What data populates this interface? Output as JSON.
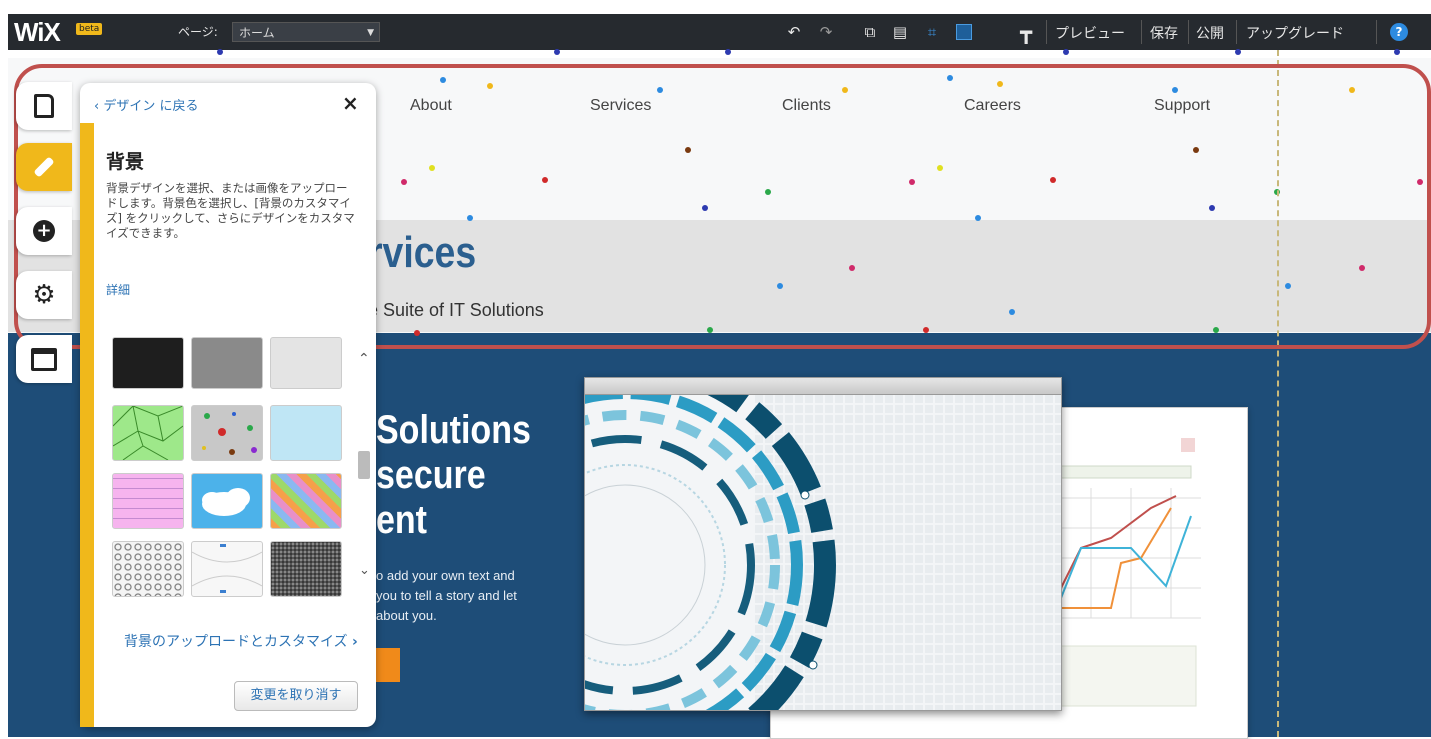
{
  "toolbar": {
    "logo": "WiX",
    "logo_badge": "beta",
    "page_label": "ページ:",
    "page_select": "ホーム",
    "preview": "プレビュー",
    "save": "保存",
    "publish": "公開",
    "upgrade": "アップグレード",
    "help": "?"
  },
  "site": {
    "nav": [
      "About",
      "Services",
      "Clients",
      "Careers",
      "Support"
    ],
    "hero_title_partial": "rvices",
    "hero_subtitle_partial": "e Suite of IT Solutions",
    "headline_lines": [
      "Solutions",
      "secure",
      "ent"
    ],
    "body_lines": [
      "o add your own text and",
      "you to tell a story and let",
      "about you."
    ]
  },
  "panel": {
    "back_link": "デザイン に戻る",
    "close": "×",
    "title": "背景",
    "description": "背景デザインを選択、または画像をアップロードします。背景色を選択し、[背景のカスタマイズ] をクリックして、さらにデザインをカスタマイズできます。",
    "more_link": "詳細",
    "upload_link": "背景のアップロードとカスタマイズ",
    "undo_button": "変更を取り消す"
  },
  "sidebar": [
    "pages-icon",
    "design-icon",
    "add-icon",
    "settings-icon",
    "store-icon"
  ],
  "colors": {
    "toolbar_bg": "#262a2f",
    "site_blue": "#1e4d78",
    "panel_accent": "#f0b81b",
    "highlight_red": "#c0504d",
    "link_blue": "#2d73b4"
  }
}
